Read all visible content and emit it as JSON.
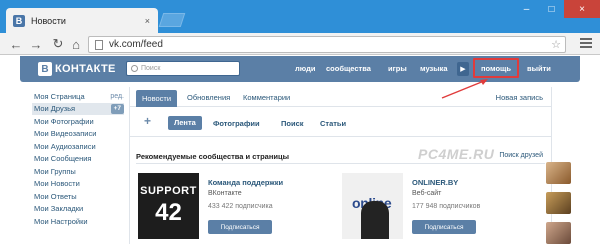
{
  "browser": {
    "tab_title": "Новости",
    "tab_favicon": "В",
    "close_glyph": "×",
    "url": "vk.com/feed",
    "win_min": "–",
    "win_max": "□",
    "win_close": "×"
  },
  "vk": {
    "logo_letter": "В",
    "logo_text": "КОНТАКТЕ",
    "search_placeholder": "Поиск",
    "nav": [
      "люди",
      "сообщества",
      "игры",
      "музыка"
    ],
    "help": "помощь",
    "logout": "выйти"
  },
  "sidebar": {
    "edit": "ред.",
    "friends_badge": "+7",
    "items": [
      "Моя Страница",
      "Мои Друзья",
      "Мои Фотографии",
      "Мои Видеозаписи",
      "Мои Аудиозаписи",
      "Мои Сообщения",
      "Мои Группы",
      "Мои Новости",
      "Мои Ответы",
      "Мои Закладки",
      "Мои Настройки"
    ]
  },
  "feed": {
    "tabs": [
      "Новости",
      "Обновления",
      "Комментарии"
    ],
    "new_post": "Новая запись",
    "plus": "+",
    "filters": [
      "Лента",
      "Фотографии",
      "Поиск",
      "Статьи"
    ],
    "rec_title": "Рекомендуемые сообщества и страницы",
    "rec_link": "Поиск друзей",
    "watermark": "PC4ME.RU"
  },
  "cards": [
    {
      "name": "Команда поддержки",
      "sub": "ВКонтакте",
      "count": "433 422 подписчика",
      "button": "Подписаться",
      "pic_line1": "SUPPORT",
      "pic_line2": "42"
    },
    {
      "name": "ONLINER.BY",
      "sub": "Веб-сайт",
      "count": "177 948 подписчиков",
      "button": "Подписаться",
      "pic_line1": "online"
    }
  ],
  "colors": {
    "chrome_blue": "#2f8fd7",
    "vk_header": "#5b7fa6",
    "link": "#2b587a",
    "highlight_red": "#e03b3b"
  }
}
